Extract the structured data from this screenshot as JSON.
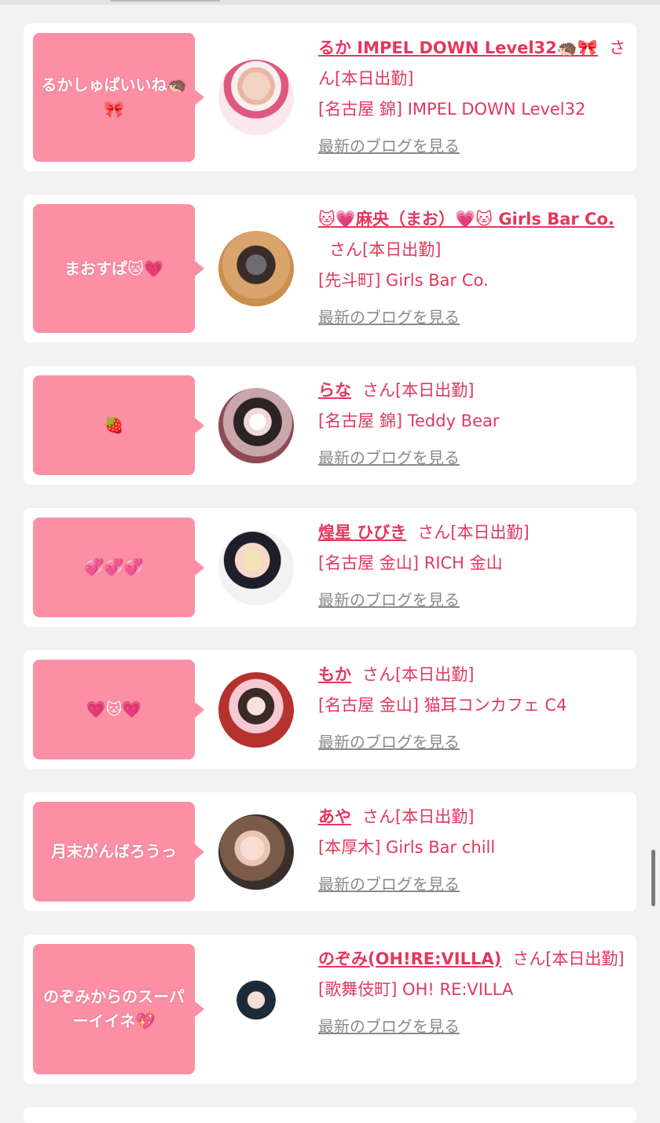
{
  "colors": {
    "accent": "#e1385d",
    "bubble": "#fd8fa5",
    "link_gray": "#8a8a8a"
  },
  "blog_link_label": "最新のブログを見る",
  "honorific": "さん",
  "cards": [
    {
      "message": "るかしゅぱいいね🦔🎀",
      "name": "るか IMPEL DOWN Level32🦔🎀",
      "status": "[本日出勤]",
      "location": "[名古屋 錦] IMPEL DOWN Level32",
      "avatar_icon": "avatar-photo-icon"
    },
    {
      "message": "まおすぱ🐱💗",
      "name": "🐱💗麻央（まお）💗🐱 Girls Bar Co.",
      "status": "[本日出勤]",
      "location": "[先斗町] Girls Bar Co.",
      "avatar_icon": "avatar-photo-icon"
    },
    {
      "message": "🍓",
      "name": "らな",
      "status": "[本日出勤]",
      "location": "[名古屋 錦] Teddy Bear",
      "avatar_icon": "avatar-photo-icon"
    },
    {
      "message": "💞💞💞",
      "name": "煌星 ひびき",
      "status": "[本日出勤]",
      "location": "[名古屋 金山] RICH 金山",
      "avatar_icon": "avatar-photo-icon"
    },
    {
      "message": "💗🐱💗",
      "name": "もか",
      "status": "[本日出勤]",
      "location": "[名古屋 金山] 猫耳コンカフェ C4",
      "avatar_icon": "avatar-photo-icon"
    },
    {
      "message": "月末がんばろうっ",
      "name": "あや",
      "status": "[本日出勤]",
      "location": "[本厚木] Girls Bar chill",
      "avatar_icon": "avatar-photo-icon"
    },
    {
      "message": "のぞみからのスーパーイイネ💖",
      "name": "のぞみ(OH!RE:VILLA)",
      "status": "[本日出勤]",
      "location": "[歌舞伎町] OH! RE:VILLA",
      "avatar_icon": "avatar-photo-icon"
    }
  ]
}
